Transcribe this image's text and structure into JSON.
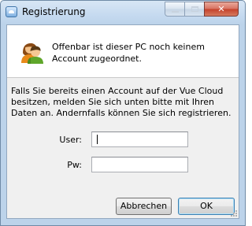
{
  "window": {
    "title": "Registrierung",
    "minimize_icon": "minimize-icon",
    "maximize_icon": "maximize-icon",
    "close_icon": "close-icon",
    "close_glyph": "✕"
  },
  "header": {
    "icon": "users-icon",
    "message": "Offenbar ist dieser PC noch keinem Account zugeordnet."
  },
  "body": {
    "info": "Falls Sie bereits einen Account auf der Vue Cloud besitzen, melden Sie sich unten bitte mit Ihren Daten an. Andernfalls können Sie sich registrieren.",
    "user_label": "User:",
    "user_value": "",
    "pw_label": "Pw:",
    "pw_value": ""
  },
  "buttons": {
    "cancel_label": "Abbrechen",
    "ok_label": "OK"
  },
  "colors": {
    "titlebar": "#c4d9ef",
    "close_button": "#c4402a",
    "body_background": "#f0f0f0",
    "default_button_border": "#3c7fb1"
  }
}
